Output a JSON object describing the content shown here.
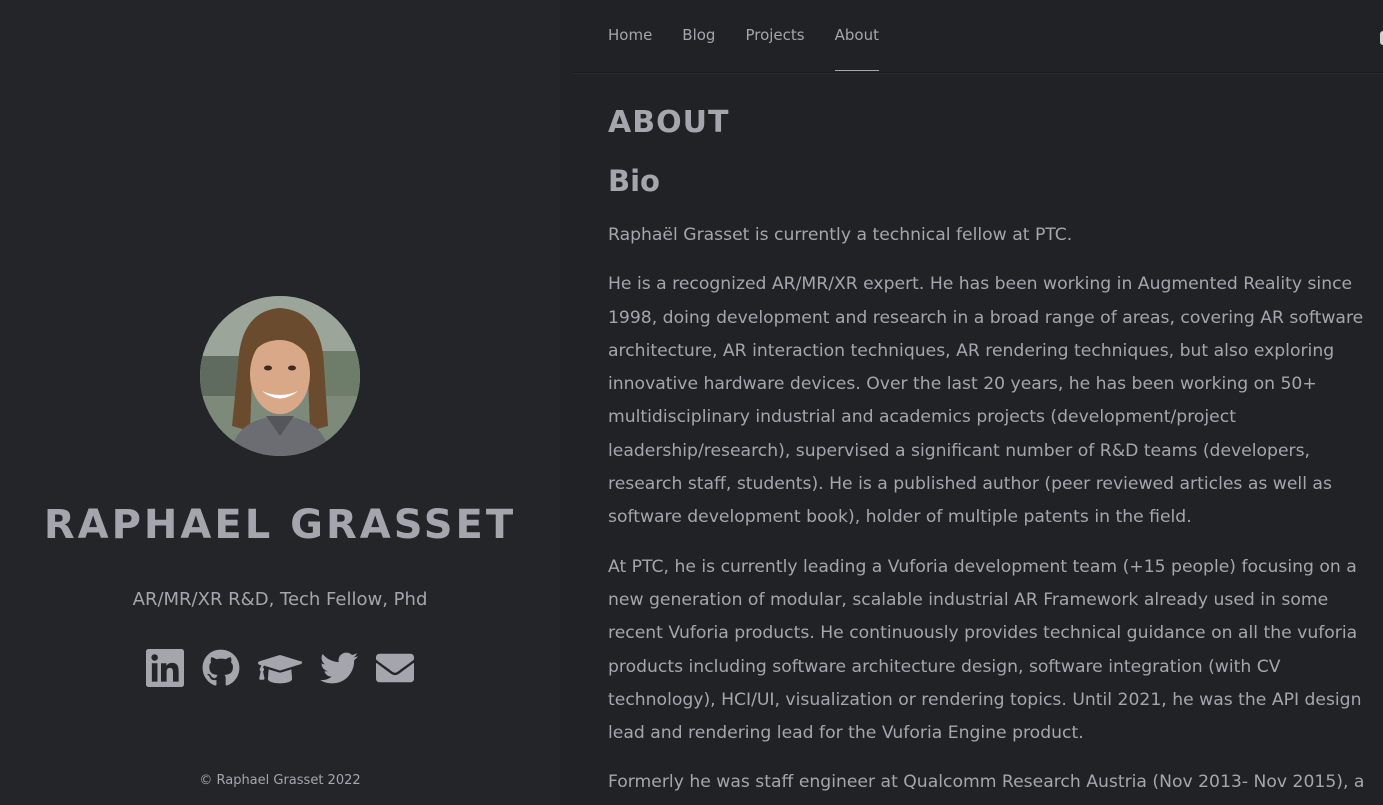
{
  "sidebar": {
    "name": "RAPHAEL GRASSET",
    "tagline": "AR/MR/XR R&D, Tech Fellow, Phd",
    "social": [
      {
        "icon": "linkedin-icon"
      },
      {
        "icon": "github-icon"
      },
      {
        "icon": "graduation-cap-icon"
      },
      {
        "icon": "twitter-icon"
      },
      {
        "icon": "envelope-icon"
      }
    ],
    "copyright": "© Raphael Grasset 2022"
  },
  "nav": {
    "items": [
      {
        "label": "Home"
      },
      {
        "label": "Blog"
      },
      {
        "label": "Projects"
      },
      {
        "label": "About"
      }
    ],
    "active": "About"
  },
  "content": {
    "title": "ABOUT",
    "subtitle": "Bio",
    "paragraphs": [
      [
        "Raphaël Grasset is currently a technical fellow at PTC."
      ],
      [
        "He is a recognized AR/MR/XR expert. He has been working in Augmented Reality since",
        "1998, doing development and research in a broad range of areas, covering AR software",
        "architecture, AR interaction techniques, AR rendering techniques, but also exploring",
        "innovative hardware devices. Over the last 20 years, he has been working on 50+",
        "multidisciplinary industrial and academics projects (development/project",
        "leadership/research), supervised a significant number of R&D teams (developers,",
        "research staff, students). He is a published author (peer reviewed articles as well as",
        "software development book), holder of multiple patents in the field."
      ],
      [
        "At PTC, he is currently leading a Vuforia development team (+15 people) focusing on a",
        "new generation of modular, scalable industrial AR Framework already used in some",
        "recent Vuforia products. He continuously provides technical guidance on all the vuforia",
        "products including software architecture design, software integration (with CV",
        "technology), HCI/UI, visualization or rendering topics. Until 2021, he was the API design",
        "lead and rendering lead for the Vuforia Engine product."
      ],
      [
        "Formerly he was staff engineer at Qualcomm Research Austria (Nov 2013- Nov 2015), a"
      ]
    ]
  },
  "colors": {
    "background": "#212225",
    "sidebar": "#242529",
    "text": "#a5a6ad"
  }
}
